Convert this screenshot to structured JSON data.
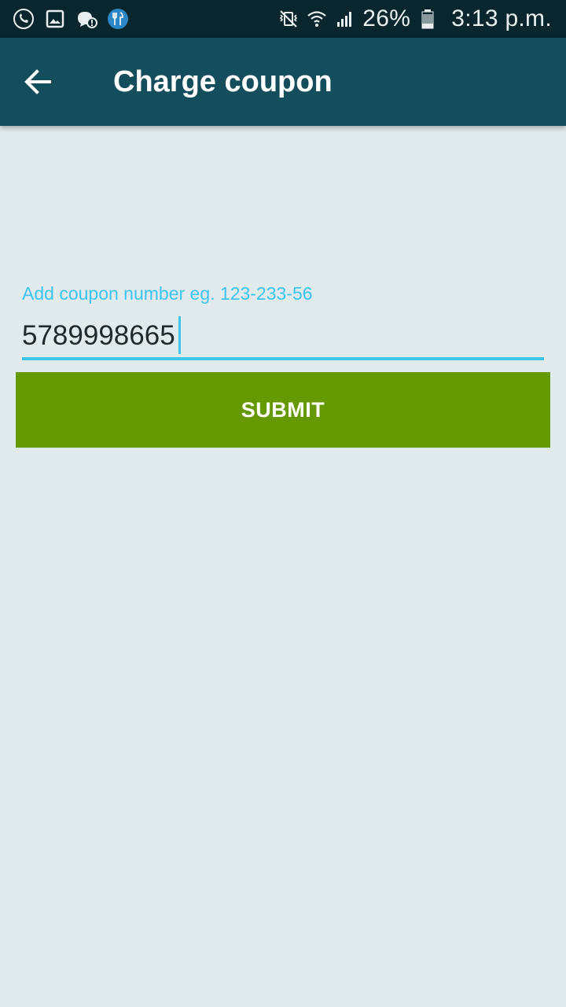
{
  "status_bar": {
    "notification_icons": [
      "call-forwarding-icon",
      "gallery-icon",
      "chat-alert-icon",
      "restaurant-app-icon"
    ],
    "system_icons": [
      "mute-vibrate-icon",
      "wifi-icon",
      "signal-icon",
      "battery-icon"
    ],
    "battery_percent": "26%",
    "time": "3:13 p.m."
  },
  "app_bar": {
    "back_icon": "arrow-back-icon",
    "title": "Charge coupon"
  },
  "form": {
    "label": "Add coupon number eg. 123-233-56",
    "value": "5789998665",
    "submit_label": "SUBMIT"
  },
  "colors": {
    "status_bar_bg": "#07262d",
    "app_bar_bg": "#144e5c",
    "page_bg": "#e1eaec",
    "accent": "#3ec4f0",
    "submit_bg": "#669900"
  }
}
